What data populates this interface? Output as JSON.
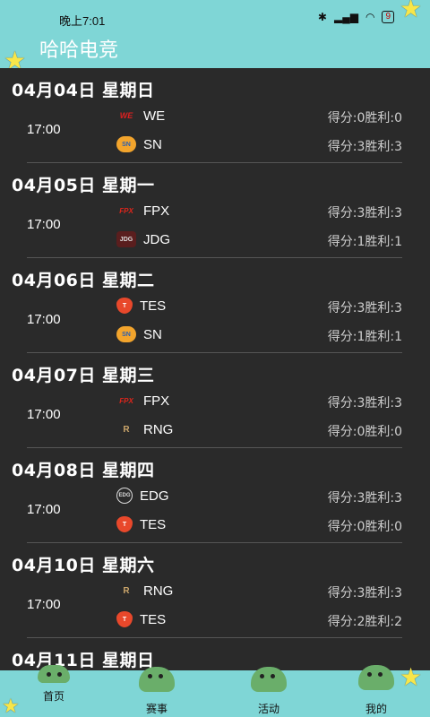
{
  "status_bar": {
    "time": "晚上7:01",
    "battery": "9"
  },
  "app": {
    "title": "哈哈电竞"
  },
  "schedule": [
    {
      "date": "04月04日  星期日",
      "time": "17:00",
      "team1": {
        "name": "WE",
        "logo": "WE",
        "score": "得分:0胜利:0"
      },
      "team2": {
        "name": "SN",
        "logo": "SN",
        "score": "得分:3胜利:3"
      }
    },
    {
      "date": "04月05日  星期一",
      "time": "17:00",
      "team1": {
        "name": "FPX",
        "logo": "FPX",
        "score": "得分:3胜利:3"
      },
      "team2": {
        "name": "JDG",
        "logo": "JDG",
        "score": "得分:1胜利:1"
      }
    },
    {
      "date": "04月06日  星期二",
      "time": "17:00",
      "team1": {
        "name": "TES",
        "logo": "T",
        "score": "得分:3胜利:3"
      },
      "team2": {
        "name": "SN",
        "logo": "SN",
        "score": "得分:1胜利:1"
      }
    },
    {
      "date": "04月07日  星期三",
      "time": "17:00",
      "team1": {
        "name": "FPX",
        "logo": "FPX",
        "score": "得分:3胜利:3"
      },
      "team2": {
        "name": "RNG",
        "logo": "R",
        "score": "得分:0胜利:0"
      }
    },
    {
      "date": "04月08日  星期四",
      "time": "17:00",
      "team1": {
        "name": "EDG",
        "logo": "EDG",
        "score": "得分:3胜利:3"
      },
      "team2": {
        "name": "TES",
        "logo": "T",
        "score": "得分:0胜利:0"
      }
    },
    {
      "date": "04月10日  星期六",
      "time": "17:00",
      "team1": {
        "name": "RNG",
        "logo": "R",
        "score": "得分:3胜利:3"
      },
      "team2": {
        "name": "TES",
        "logo": "T",
        "score": "得分:2胜利:2"
      }
    },
    {
      "date": "04月11日  星期日",
      "time": "",
      "team1": {
        "name": "",
        "logo": "",
        "score": ""
      },
      "team2": {
        "name": "",
        "logo": "",
        "score": ""
      }
    }
  ],
  "tabs": [
    {
      "label": "首页",
      "icon": "dino-home-icon"
    },
    {
      "label": "赛事",
      "icon": "dino-match-icon"
    },
    {
      "label": "活动",
      "icon": "dino-activity-icon"
    },
    {
      "label": "我的",
      "icon": "dino-profile-icon"
    }
  ],
  "colors": {
    "header": "#7fd6d6",
    "background": "#2a2a2a",
    "star": "#f7e64a"
  }
}
